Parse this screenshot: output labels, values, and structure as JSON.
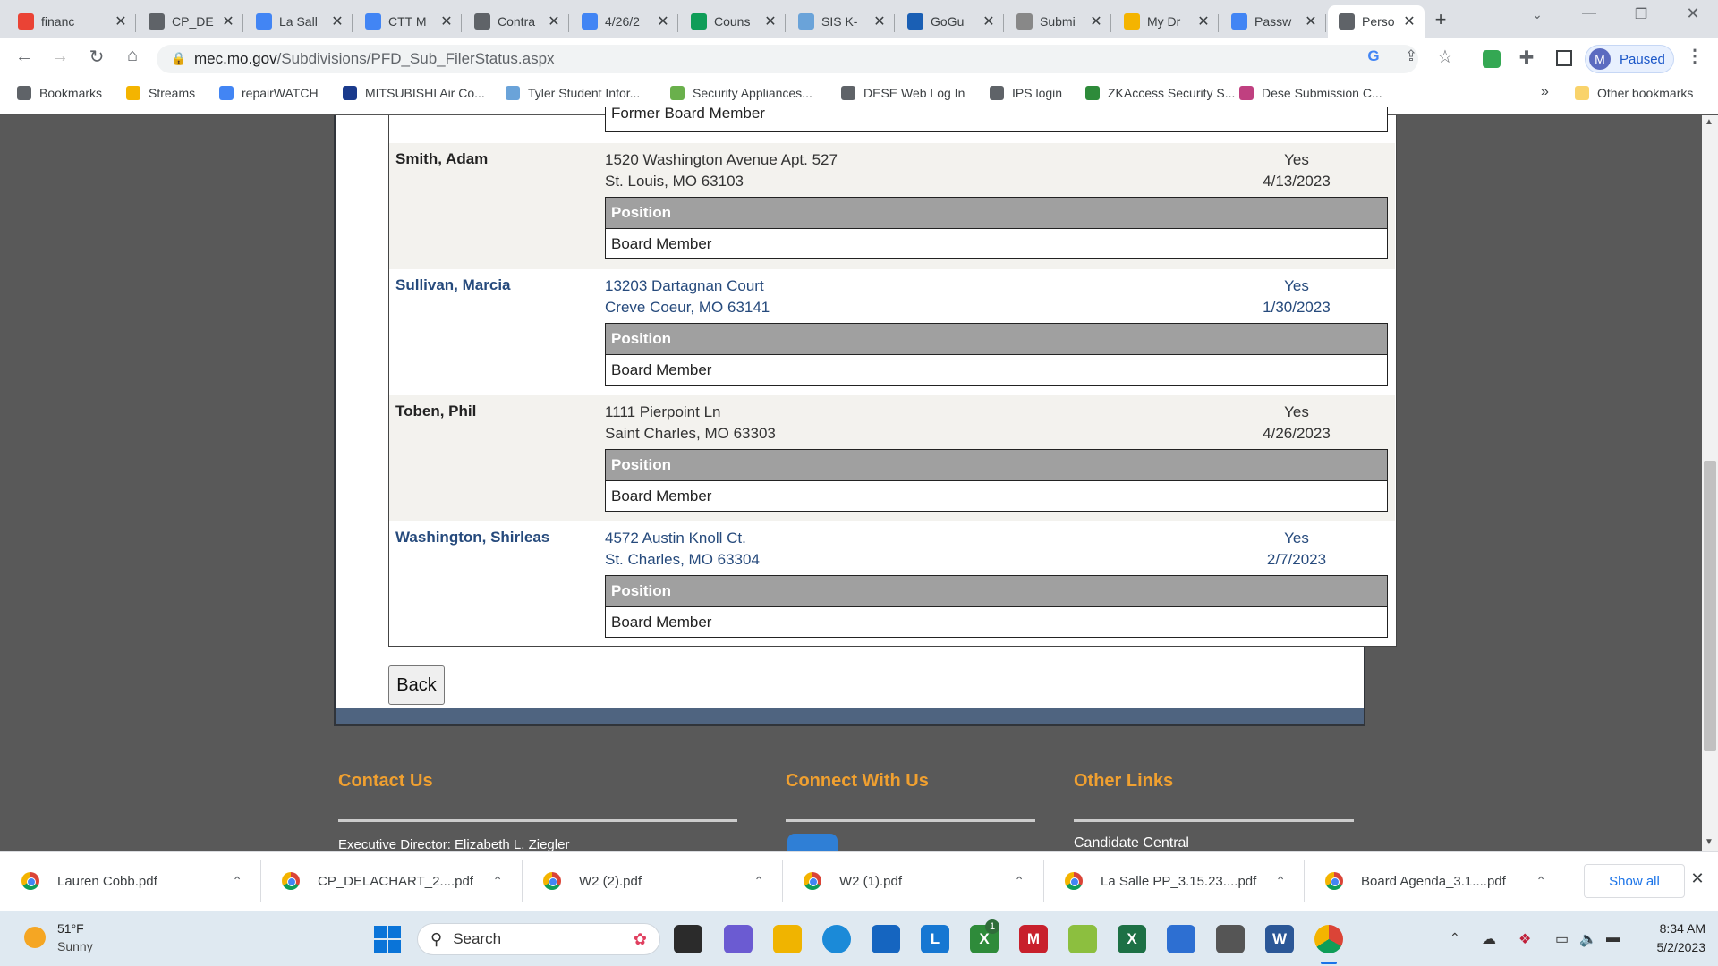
{
  "tabs": [
    {
      "label": "financ",
      "icon": "gmail-icon",
      "color": "#ea4335"
    },
    {
      "label": "CP_DE",
      "icon": "globe-icon",
      "color": "#5f6368"
    },
    {
      "label": "La Sall",
      "icon": "calendar-icon",
      "color": "#4285f4"
    },
    {
      "label": "CTT M",
      "icon": "docs-icon",
      "color": "#4285f4"
    },
    {
      "label": "Contra",
      "icon": "globe-icon",
      "color": "#5f6368"
    },
    {
      "label": "4/26/2",
      "icon": "docs-icon",
      "color": "#4285f4"
    },
    {
      "label": "Couns",
      "icon": "sheets-icon",
      "color": "#0f9d58"
    },
    {
      "label": "SIS K-",
      "icon": "sis-icon",
      "color": "#6aa3d9"
    },
    {
      "label": "GoGu",
      "icon": "shield-icon",
      "color": "#1a5fb4"
    },
    {
      "label": "Submi",
      "icon": "submit-icon",
      "color": "#888888"
    },
    {
      "label": "My Dr",
      "icon": "drive-icon",
      "color": "#f4b400"
    },
    {
      "label": "Passw",
      "icon": "docs-icon",
      "color": "#4285f4"
    },
    {
      "label": "Perso",
      "icon": "globe-icon",
      "color": "#5f6368"
    }
  ],
  "address": {
    "domain": "mec.mo.gov",
    "path": "/Subdivisions/PFD_Sub_FilerStatus.aspx"
  },
  "profile": {
    "initial": "M",
    "status": "Paused"
  },
  "bookmarks": [
    "Bookmarks",
    "Streams",
    "repairWATCH",
    "MITSUBISHI Air Co...",
    "Tyler Student Infor...",
    "Security Appliances...",
    "DESE Web Log In",
    "IPS login",
    "ZKAccess Security S...",
    "Dese Submission C..."
  ],
  "other_bookmarks": "Other bookmarks",
  "bookmarks_overflow": "»",
  "partial_position": "Former Board Member",
  "members": [
    {
      "name": "Smith, Adam",
      "addr1": "1520 Washington Avenue Apt. 527",
      "addr2": "St. Louis, MO 63103",
      "filed": "Yes",
      "date": "4/13/2023",
      "pos_header": "Position",
      "position": "Board Member"
    },
    {
      "name": "Sullivan, Marcia",
      "addr1": "13203 Dartagnan Court",
      "addr2": "Creve Coeur, MO 63141",
      "filed": "Yes",
      "date": "1/30/2023",
      "pos_header": "Position",
      "position": "Board Member"
    },
    {
      "name": "Toben, Phil",
      "addr1": "1111 Pierpoint Ln",
      "addr2": "Saint Charles, MO 63303",
      "filed": "Yes",
      "date": "4/26/2023",
      "pos_header": "Position",
      "position": "Board Member"
    },
    {
      "name": "Washington, Shirleas",
      "addr1": "4572 Austin Knoll Ct.",
      "addr2": "St. Charles, MO 63304",
      "filed": "Yes",
      "date": "2/7/2023",
      "pos_header": "Position",
      "position": "Board Member"
    }
  ],
  "back_label": "Back",
  "footer": {
    "contact_title": "Contact Us",
    "connect_title": "Connect With Us",
    "links_title": "Other Links",
    "contact_text": "Executive Director:  Elizabeth L. Ziegler",
    "links_text": "Candidate Central"
  },
  "downloads": [
    "Lauren Cobb.pdf",
    "CP_DELACHART_2....pdf",
    "W2 (2).pdf",
    "W2 (1).pdf",
    "La Salle PP_3.15.23....pdf",
    "Board Agenda_3.1....pdf"
  ],
  "show_all": "Show all",
  "taskbar": {
    "weather_temp": "51°F",
    "weather_desc": "Sunny",
    "search_placeholder": "Search",
    "time": "8:34 AM",
    "date": "5/2/2023",
    "badge": "1"
  }
}
